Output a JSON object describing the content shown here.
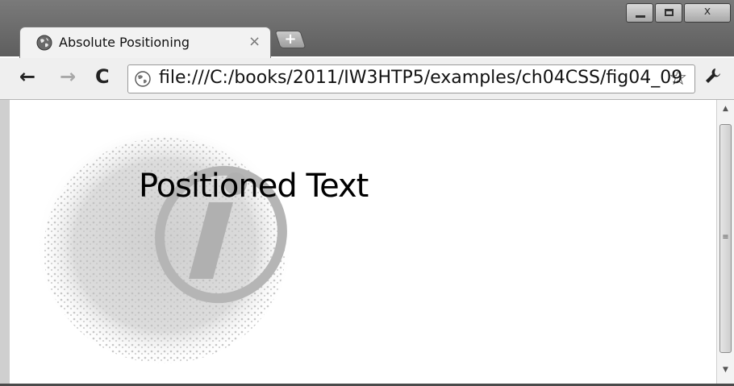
{
  "window": {
    "buttons": {
      "minimize": "",
      "maximize": "",
      "close": "x"
    }
  },
  "tabs": [
    {
      "title": "Absolute Positioning",
      "close_label": "×",
      "favicon": "globe-icon"
    }
  ],
  "new_tab_label": "+",
  "toolbar": {
    "back_label": "←",
    "forward_label": "→",
    "reload_label": "C",
    "url": "file:///C:/books/2011/IW3HTP5/examples/ch04CSS/fig04_09",
    "bookmark_star": "☆",
    "wrench": "🔧"
  },
  "page": {
    "positioned_text": "Positioned Text",
    "background_image": "info-i-logo"
  },
  "scrollbar": {
    "up": "▲",
    "down": "▼",
    "grip": "≡"
  }
}
